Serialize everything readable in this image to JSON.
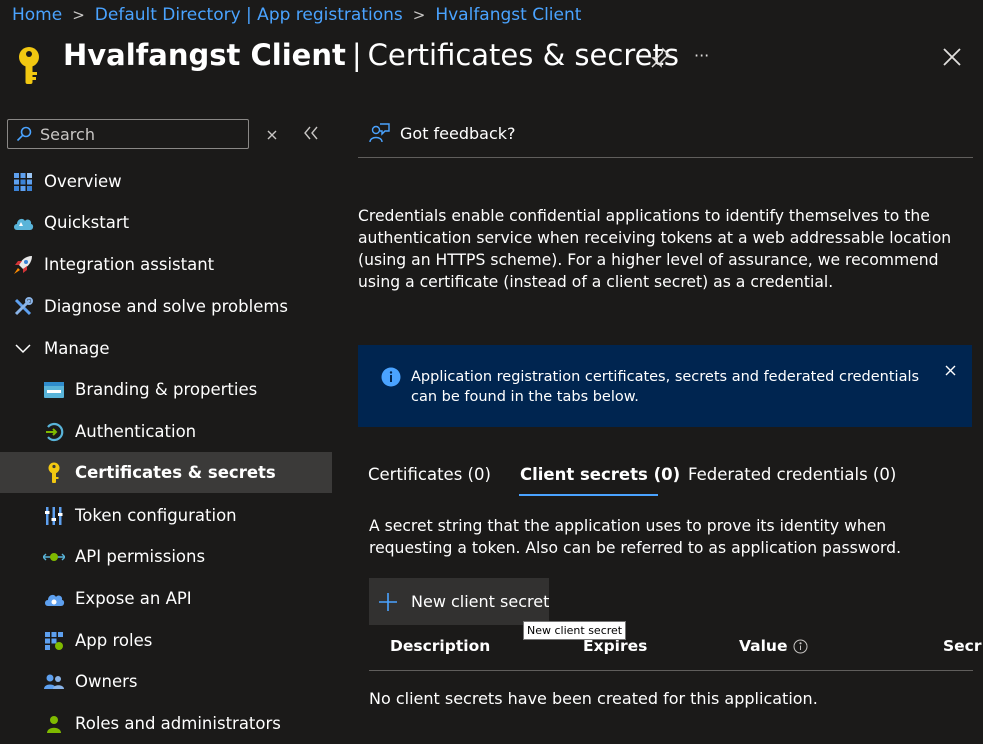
{
  "breadcrumb": [
    "Home",
    "Default Directory | App registrations",
    "Hvalfangst Client"
  ],
  "header": {
    "app_name": "Hvalfangst Client",
    "separator": "|",
    "page_title": "Certificates & secrets",
    "more_label": "···"
  },
  "search": {
    "placeholder": "Search"
  },
  "sidebar": {
    "items": [
      {
        "label": "Overview",
        "icon": "overview-icon"
      },
      {
        "label": "Quickstart",
        "icon": "cloud-icon"
      },
      {
        "label": "Integration assistant",
        "icon": "rocket-icon"
      },
      {
        "label": "Diagnose and solve problems",
        "icon": "wrench-icon"
      },
      {
        "label": "Manage",
        "icon": "chevron-down-icon"
      },
      {
        "label": "Branding & properties",
        "icon": "branding-icon"
      },
      {
        "label": "Authentication",
        "icon": "authentication-icon"
      },
      {
        "label": "Certificates & secrets",
        "icon": "key-icon"
      },
      {
        "label": "Token configuration",
        "icon": "token-icon"
      },
      {
        "label": "API permissions",
        "icon": "api-permissions-icon"
      },
      {
        "label": "Expose an API",
        "icon": "cloud-api-icon"
      },
      {
        "label": "App roles",
        "icon": "app-roles-icon"
      },
      {
        "label": "Owners",
        "icon": "owners-icon"
      },
      {
        "label": "Roles and administrators",
        "icon": "roles-icon"
      }
    ]
  },
  "main": {
    "feedback_label": "Got feedback?",
    "description": "Credentials enable confidential applications to identify themselves to the authentication service when receiving tokens at a web addressable location (using an HTTPS scheme). For a higher level of assurance, we recommend using a certificate (instead of a client secret) as a credential.",
    "info_banner": "Application registration certificates, secrets and federated credentials can be found in the tabs below.",
    "tabs": [
      {
        "label": "Certificates (0)"
      },
      {
        "label": "Client secrets (0)"
      },
      {
        "label": "Federated credentials (0)"
      }
    ],
    "tab_description": "A secret string that the application uses to prove its identity when requesting a token. Also can be referred to as application password.",
    "new_secret_label": "New client secret",
    "tooltip": "New client secret",
    "columns": [
      "Description",
      "Expires",
      "Value",
      "Secr"
    ],
    "empty_message": "No client secrets have been created for this application."
  },
  "colors": {
    "background": "#1b1a19",
    "link": "#4aa3ff",
    "active_item": "#3b3a39",
    "info_banner": "#002550",
    "button": "#323130"
  }
}
